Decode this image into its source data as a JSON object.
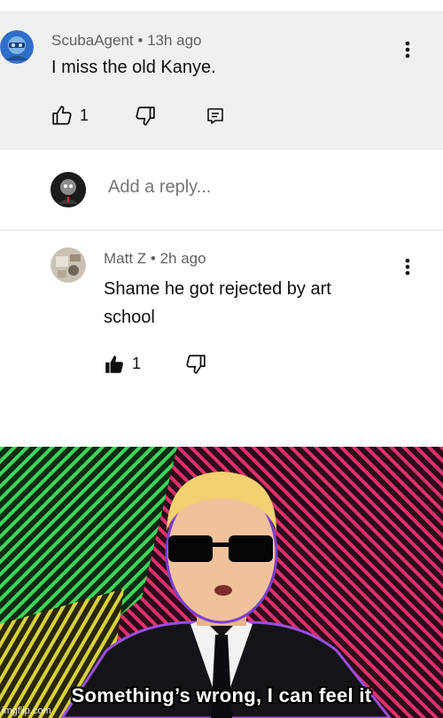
{
  "comment": {
    "author": "ScubaAgent",
    "time": "13h ago",
    "text": "I miss the old Kanye.",
    "likes": "1"
  },
  "reply_box": {
    "placeholder": "Add a reply..."
  },
  "reply": {
    "author": "Matt Z",
    "time": "2h ago",
    "text": "Shame he got rejected by art school",
    "likes": "1"
  },
  "meta_separator": "•",
  "meme": {
    "caption": "Something’s wrong, I can feel it",
    "watermark": "imgflip.com"
  },
  "icons": {
    "more": "more-vert-icon",
    "like": "thumb-up-icon",
    "dislike": "thumb-down-icon",
    "reply": "reply-icon"
  },
  "colors": {
    "comment_bg": "#f0f0f0",
    "meta_text": "#606060",
    "body_text": "#0f0f0f",
    "placeholder_text": "#6f6f6f"
  }
}
